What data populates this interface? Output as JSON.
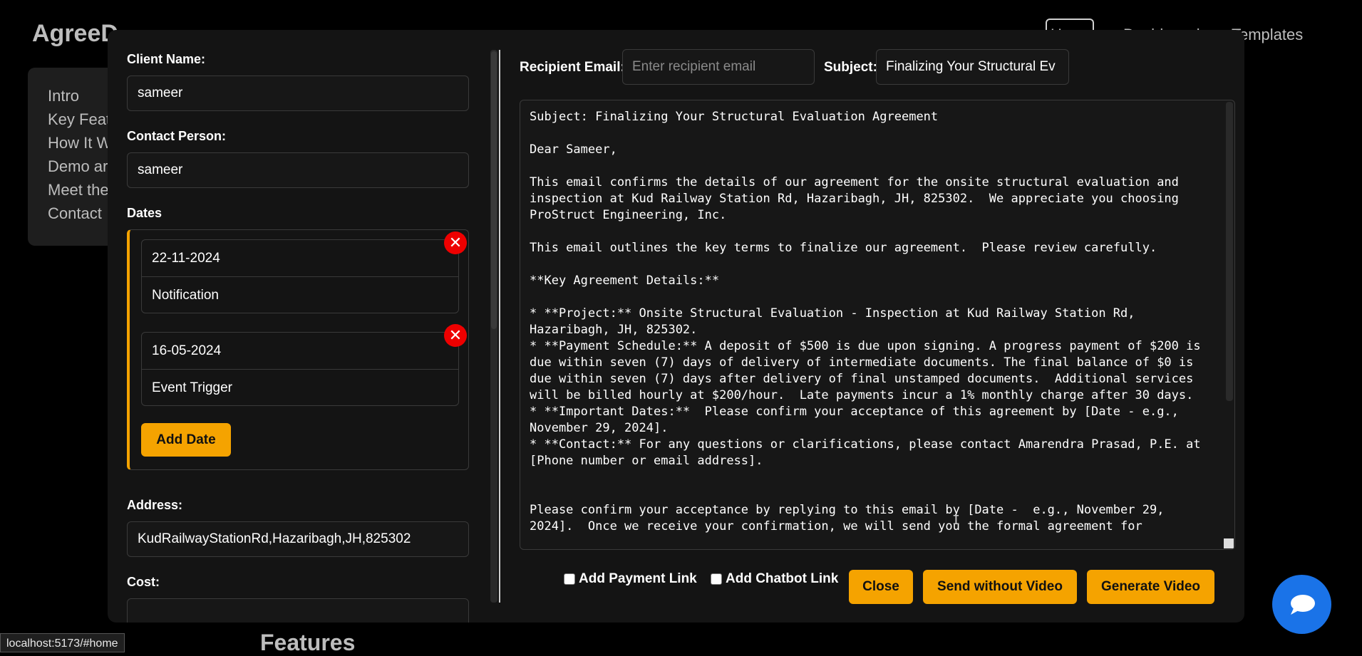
{
  "background": {
    "logo": "AgreeD",
    "nav": [
      "Home",
      "Dashboard",
      "Templates"
    ],
    "sidebar_items": [
      "Intro",
      "Key Feat",
      "How It W",
      "Demo ar",
      "Meet the",
      "Contact"
    ],
    "section_heading": "Features",
    "status_url": "localhost:5173/#home"
  },
  "form": {
    "client_name_label": "Client Name:",
    "client_name_value": "sameer",
    "contact_person_label": "Contact Person:",
    "contact_person_value": "sameer",
    "dates_label": "Dates",
    "dates": [
      {
        "date": "22-11-2024",
        "type": "Notification"
      },
      {
        "date": "16-05-2024",
        "type": "Event Trigger"
      }
    ],
    "add_date_label": "Add Date",
    "address_label": "Address:",
    "address_value": "KudRailwayStationRd,Hazaribagh,JH,825302",
    "cost_label": "Cost:"
  },
  "email": {
    "recipient_label": "Recipient Email:",
    "recipient_placeholder": "Enter recipient email",
    "subject_label": "Subject:",
    "subject_value": "Finalizing Your Structural Ev",
    "body": "Subject: Finalizing Your Structural Evaluation Agreement\n\nDear Sameer,\n\nThis email confirms the details of our agreement for the onsite structural evaluation and inspection at Kud Railway Station Rd, Hazaribagh, JH, 825302.  We appreciate you choosing ProStruct Engineering, Inc.\n\nThis email outlines the key terms to finalize our agreement.  Please review carefully.\n\n**Key Agreement Details:**\n\n* **Project:** Onsite Structural Evaluation - Inspection at Kud Railway Station Rd, Hazaribagh, JH, 825302.\n* **Payment Schedule:** A deposit of $500 is due upon signing. A progress payment of $200 is due within seven (7) days of delivery of intermediate documents. The final balance of $0 is due within seven (7) days after delivery of final unstamped documents.  Additional services will be billed hourly at $200/hour.  Late payments incur a 1% monthly charge after 30 days.\n* **Important Dates:**  Please confirm your acceptance of this agreement by [Date - e.g., November 29, 2024].\n* **Contact:** For any questions or clarifications, please contact Amarendra Prasad, P.E. at [Phone number or email address].\n\n\nPlease confirm your acceptance by replying to this email by [Date -  e.g., November 29, 2024].  Once we receive your confirmation, we will send you the formal agreement for"
  },
  "actions": {
    "payment_link_label": "Add Payment Link",
    "chatbot_link_label": "Add Chatbot Link",
    "close_label": "Close",
    "send_without_video_label": "Send without Video",
    "generate_video_label": "Generate Video"
  },
  "colors": {
    "accent": "#f5a300",
    "danger": "#ee0000",
    "fab": "#1a73e8"
  }
}
